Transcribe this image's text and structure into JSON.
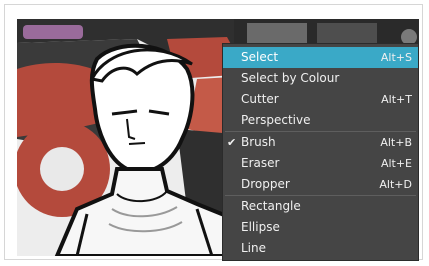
{
  "menu": {
    "groups": [
      {
        "items": [
          {
            "label": "Select",
            "shortcut": "Alt+S",
            "selected": true,
            "checked": false
          },
          {
            "label": "Select by Colour",
            "shortcut": "",
            "selected": false,
            "checked": false
          },
          {
            "label": "Cutter",
            "shortcut": "Alt+T",
            "selected": false,
            "checked": false
          },
          {
            "label": "Perspective",
            "shortcut": "",
            "selected": false,
            "checked": false
          }
        ]
      },
      {
        "items": [
          {
            "label": "Brush",
            "shortcut": "Alt+B",
            "selected": false,
            "checked": true
          },
          {
            "label": "Eraser",
            "shortcut": "Alt+E",
            "selected": false,
            "checked": false
          },
          {
            "label": "Dropper",
            "shortcut": "Alt+D",
            "selected": false,
            "checked": false
          }
        ]
      },
      {
        "items": [
          {
            "label": "Rectangle",
            "shortcut": "",
            "selected": false,
            "checked": false
          },
          {
            "label": "Ellipse",
            "shortcut": "",
            "selected": false,
            "checked": false
          },
          {
            "label": "Line",
            "shortcut": "",
            "selected": false,
            "checked": false
          }
        ]
      }
    ],
    "check_glyph": "✔"
  },
  "colors": {
    "highlight": "#3aa9c7",
    "menu_background": "#454545",
    "artwork_red": "#b44a3c",
    "artwork_purple": "#9a6b9b"
  }
}
